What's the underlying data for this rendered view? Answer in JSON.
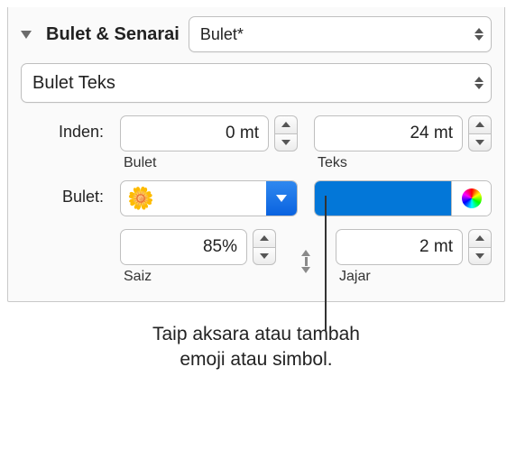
{
  "header": {
    "title": "Bulet & Senarai",
    "style_value": "Bulet*"
  },
  "type_select": {
    "value": "Bulet Teks"
  },
  "inden": {
    "label": "Inden:",
    "bullet": {
      "value": "0 mt",
      "sub": "Bulet"
    },
    "text": {
      "value": "24 mt",
      "sub": "Teks"
    }
  },
  "bulet": {
    "label": "Bulet:",
    "emoji": "🌼",
    "size": {
      "value": "85%",
      "sub": "Saiz"
    },
    "align": {
      "value": "2 mt",
      "sub": "Jajar"
    },
    "color": "#0377d8"
  },
  "callout": {
    "line1": "Taip aksara atau tambah",
    "line2": "emoji atau simbol."
  }
}
